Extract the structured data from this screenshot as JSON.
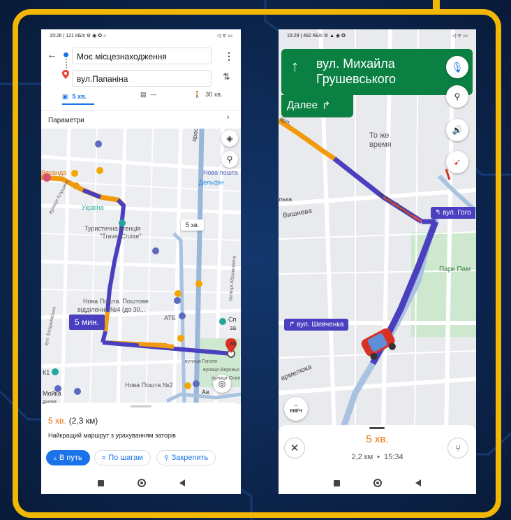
{
  "left_phone": {
    "status_left": "15:26 | 121 КБ/с ⚙ ◉ ✪ ⌂",
    "status_right": "◁ ᯤ ▭",
    "origin": "Моє місцезнаходження",
    "destination": "вул.Папаніна",
    "modes": {
      "car": "5 хв.",
      "transit": "—",
      "walk": "30 хв."
    },
    "params_label": "Параметри",
    "map_labels": {
      "prospekt": "проспект С",
      "nova_poshta_top": "Нова пошта",
      "delfin": "Дельфін",
      "veranda": "Веранда",
      "ukraina": "Україна",
      "travel1": "Туристична агенція",
      "travel2": "\"Travel Cruise\"",
      "np4a": "Нова Пошта. Поштове",
      "np4b": "відділення №4 (до 30...",
      "atb": "АТБ",
      "gogolya": "вулиця Гоголя",
      "verkhnya": "вулиця Верхньо",
      "osyp": "вулиця Осип",
      "np2": "Нова Пошта №2",
      "moika1": "Мойка",
      "moika2": "ание...",
      "k1": "К1",
      "sp": "Сп",
      "za1": "за",
      "za2": "за",
      "av": "Ав",
      "klushyna": "вулиця Клушина",
      "bogdanivska": "вул. Богданівська",
      "adramovicha": "вулиця Абрамовича"
    },
    "alt_route_time": "5 хв.",
    "route_label": "5 мин.",
    "summary_time": "5 хв.",
    "summary_dist": "(2,3 км)",
    "summary_desc": "Найкращий маршрут з урахуванням заторів",
    "btn_go": "В путь",
    "btn_steps": "По шагам",
    "btn_pin": "Закрепить"
  },
  "right_phone": {
    "status_left": "15:29 | 482 КБ/с ⚙ ▲ ◉ ✪",
    "status_right": "◁ ᯤ ▭",
    "street_line1": "вул. Михайла",
    "street_line2": "Грушевського",
    "then_label": "Далее",
    "same_time1": "То же",
    "same_time2": "время",
    "map_labels": {
      "vyshneva": "Вишнева",
      "lka": "лька",
      "gorkogo": "вулиця Горького",
      "park": "Парк Пам",
      "armelyuka": "армелюка",
      "vul": "вул."
    },
    "next_turn": "вул. Гого",
    "turn_shev": "вул. Шевченка",
    "speed_unit": "КМ/Ч",
    "speed_dash": "--",
    "eta_time": "5 хв.",
    "eta_dist": "2,2 км",
    "eta_sep": "•",
    "eta_clock": "15:34"
  },
  "colors": {
    "frame": "#f2b705",
    "route": "#4a3fbf",
    "traffic": "#f29a0e",
    "nav_green": "#0b8043",
    "orange_text": "#e8710a"
  }
}
